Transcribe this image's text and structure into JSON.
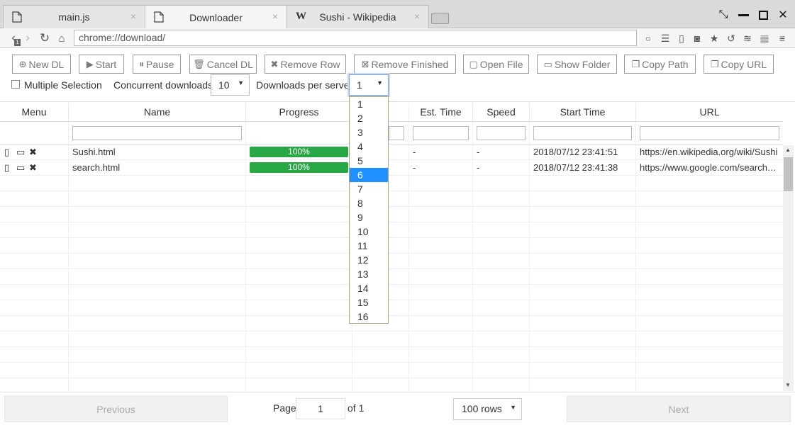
{
  "tabs": [
    {
      "label": "main.js",
      "icon": "file-icon",
      "active": false
    },
    {
      "label": "Downloader",
      "icon": "file-icon",
      "active": true
    },
    {
      "label": "Sushi - Wikipedia",
      "icon": "wikipedia-icon",
      "active": false
    }
  ],
  "tab_close_glyph": "×",
  "window": {
    "restore_glyph": "⤡",
    "minimize_glyph": "—",
    "maximize_glyph": "☐",
    "close_glyph": "✕"
  },
  "address": {
    "url": "chrome://download/",
    "history_badge": "1"
  },
  "toolbar": {
    "new_dl": "New DL",
    "start": "Start",
    "pause": "Pause",
    "cancel_dl": "Cancel DL",
    "remove_row": "Remove Row",
    "remove_finished": "Remove Finished",
    "open_file": "Open File",
    "show_folder": "Show Folder",
    "copy_path": "Copy Path",
    "copy_url": "Copy URL"
  },
  "options": {
    "multiple_selection": "Multiple Selection",
    "concurrent_label": "Concurrent downloads:",
    "concurrent_value": "10",
    "per_server_label": "Downloads per server:",
    "per_server_value": "1"
  },
  "dropdown": {
    "options": [
      "1",
      "2",
      "3",
      "4",
      "5",
      "6",
      "7",
      "8",
      "9",
      "10",
      "11",
      "12",
      "13",
      "14",
      "15",
      "16"
    ],
    "highlighted": "6"
  },
  "columns": [
    "Menu",
    "Name",
    "Progress",
    "Est. Time",
    "Speed",
    "Start Time",
    "URL"
  ],
  "rows": [
    {
      "name": "Sushi.html",
      "progress": "100%",
      "progress_value": 1.0,
      "est": "-",
      "speed": "-",
      "start": "2018/07/12 23:41:51",
      "url": "https://en.wikipedia.org/wiki/Sushi"
    },
    {
      "name": "search.html",
      "progress": "100%",
      "progress_value": 1.0,
      "est": "-",
      "speed": "-",
      "start": "2018/07/12 23:41:38",
      "url": "https://www.google.com/search?q=sushi"
    }
  ],
  "footer": {
    "previous": "Previous",
    "page_label": "Page",
    "page_value": "1",
    "of_label": "of 1",
    "rows_value": "100 rows",
    "next": "Next"
  },
  "colors": {
    "progress": "#28a745",
    "dropdown_highlight": "#1e90ff",
    "focus_border": "#7ea7d8"
  }
}
